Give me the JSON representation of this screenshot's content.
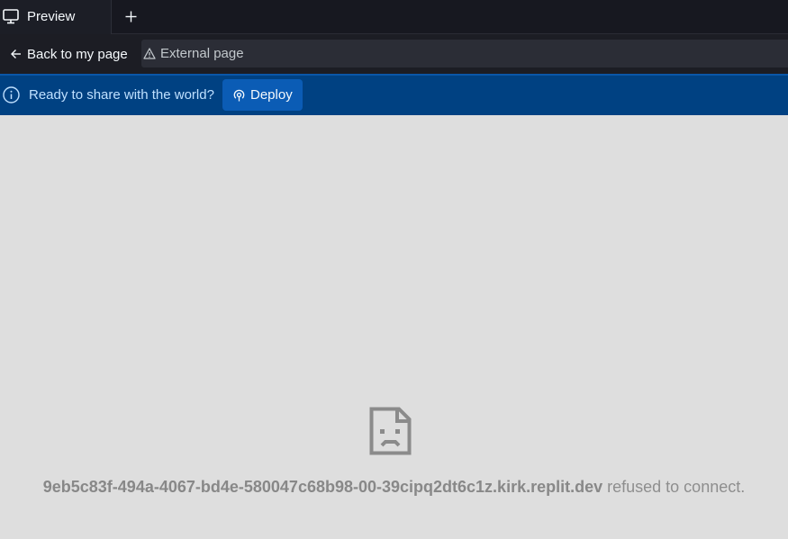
{
  "tabbar": {
    "tab_label": "Preview",
    "tab_icon": "monitor-icon",
    "new_tab_icon": "plus-icon"
  },
  "nav": {
    "back_label": "Back to my page",
    "back_icon": "arrow-left-icon",
    "address_icon": "warning-icon",
    "address_text": "External page"
  },
  "banner": {
    "icon": "info-icon",
    "text": "Ready to share with the world?",
    "deploy_label": "Deploy",
    "deploy_icon": "deploy-icon",
    "background": "#004182",
    "button_color": "#0b5cb5"
  },
  "content": {
    "icon": "sad-page-icon",
    "host": "9eb5c83f-494a-4067-bd4e-580047c68b98-00-39cipq2dt6c1z.kirk.replit.dev",
    "message": " refused to connect.",
    "background": "#dedede"
  }
}
